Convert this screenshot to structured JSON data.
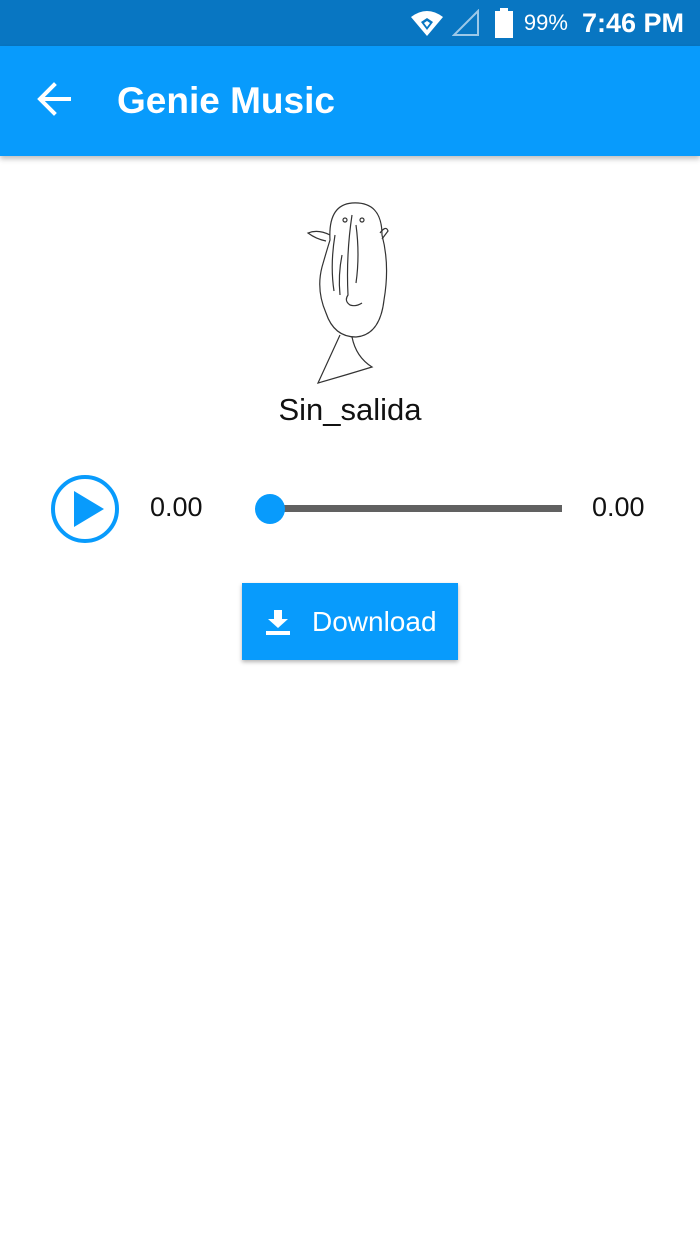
{
  "status_bar": {
    "battery_percent": "99%",
    "time": "7:46 PM",
    "icons": [
      "wifi-icon",
      "cell-signal-icon",
      "battery-icon"
    ]
  },
  "app_bar": {
    "title": "Genie Music",
    "back_icon": "arrow-back-icon"
  },
  "player": {
    "track_title": "Sin_salida",
    "artwork": "sketch-drawing",
    "current_time": "0.00",
    "total_time": "0.00",
    "progress": 0,
    "play_icon": "play-icon"
  },
  "download": {
    "label": "Download",
    "icon": "download-icon"
  },
  "colors": {
    "status_bar": "#0876c2",
    "app_bar": "#089bfc",
    "accent": "#089bfc",
    "seek_track": "#616161"
  }
}
